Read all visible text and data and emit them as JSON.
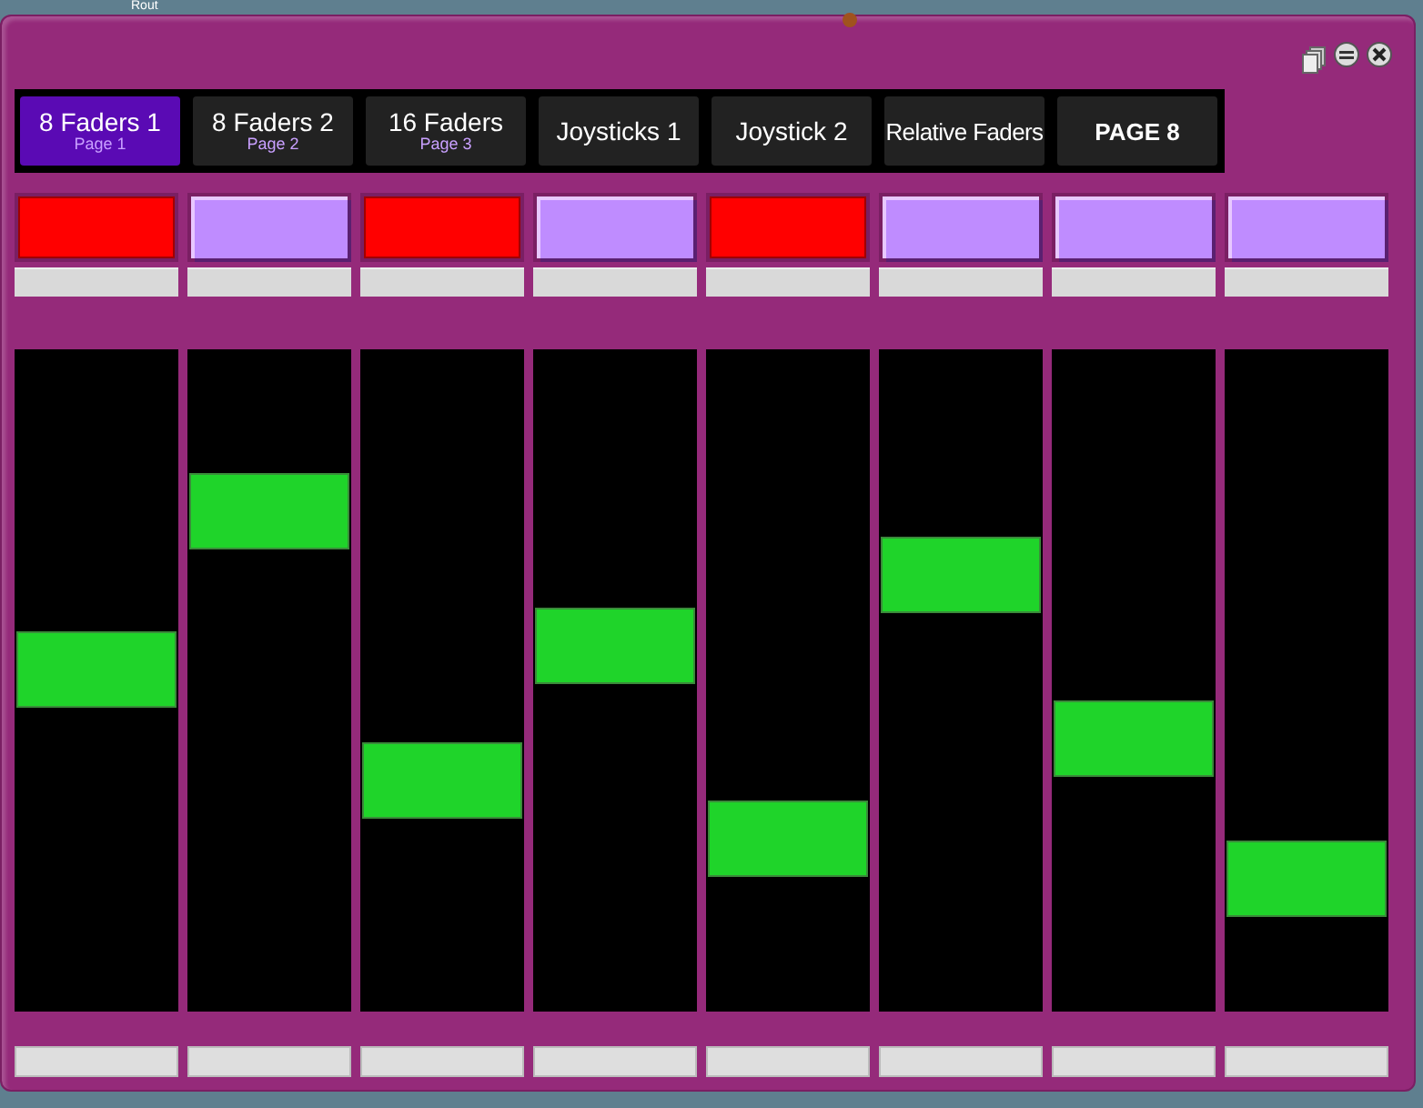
{
  "desktop": {
    "label": "Rout"
  },
  "tabs": [
    {
      "label": "8 Faders 1",
      "sublabel": "Page 1",
      "selected": true
    },
    {
      "label": "8 Faders 2",
      "sublabel": "Page 2",
      "selected": false
    },
    {
      "label": "16 Faders",
      "sublabel": "Page 3",
      "selected": false
    },
    {
      "label": "Joysticks 1",
      "selected": false
    },
    {
      "label": "Joystick 2",
      "selected": false
    },
    {
      "label": "Relative Faders",
      "selected": false
    },
    {
      "label": "PAGE 8",
      "selected": false
    }
  ],
  "channels": [
    {
      "on": true,
      "level": 0.52
    },
    {
      "on": false,
      "level": 0.79
    },
    {
      "on": true,
      "level": 0.33
    },
    {
      "on": false,
      "level": 0.56
    },
    {
      "on": true,
      "level": 0.23
    },
    {
      "on": false,
      "level": 0.68
    },
    {
      "on": false,
      "level": 0.4
    },
    {
      "on": false,
      "level": 0.16
    }
  ]
}
